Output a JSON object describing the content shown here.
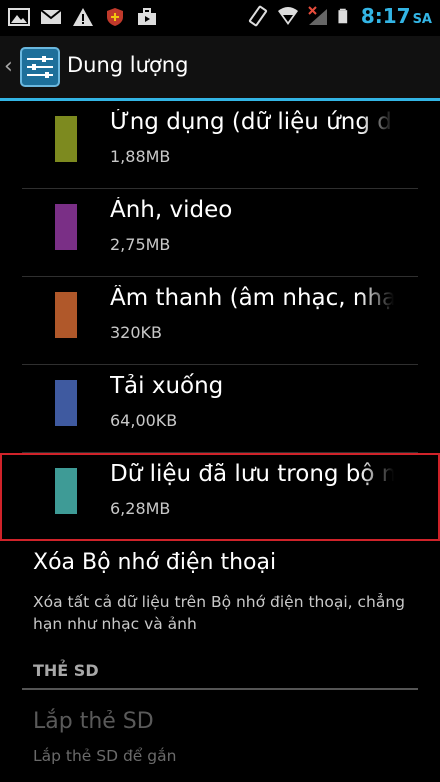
{
  "status_bar": {
    "time": "8:17",
    "ampm": "SA",
    "icons": [
      "image-icon",
      "gmail-icon",
      "warning-icon",
      "shield-icon",
      "briefcase-icon",
      "rotate-icon",
      "wifi-icon",
      "no-signal-icon",
      "battery-icon"
    ]
  },
  "action_bar": {
    "title": "Dung lượng",
    "back_icon": "chevron-left-icon",
    "app_icon": "settings-sliders-icon"
  },
  "storage_items": [
    {
      "name": "Ứng dụng (dữ liệu ứng dụng",
      "size": "1,88MB",
      "color": "#7d8a1f"
    },
    {
      "name": "Ảnh, video",
      "size": "2,75MB",
      "color": "#7a2f86"
    },
    {
      "name": "Âm thanh (âm nhạc, nhạc c",
      "size": "320KB",
      "color": "#b0582a"
    },
    {
      "name": "Tải xuống",
      "size": "64,00KB",
      "color": "#3f5aa0"
    },
    {
      "name": "Dữ liệu đã lưu trong bộ nhớ",
      "size": "6,28MB",
      "color": "#3e9b96"
    }
  ],
  "erase": {
    "title": "Xóa Bộ nhớ điện thoại",
    "description": "Xóa tất cả dữ liệu trên Bộ nhớ điện thoại, chẳng hạn như nhạc và ảnh"
  },
  "sd_section": {
    "header": "THẺ SD",
    "mount_title": "Lắp thẻ SD",
    "mount_description": "Lắp thẻ SD để gắn"
  },
  "colors": {
    "accent": "#33b5e5",
    "highlight_border": "#d0232a"
  }
}
